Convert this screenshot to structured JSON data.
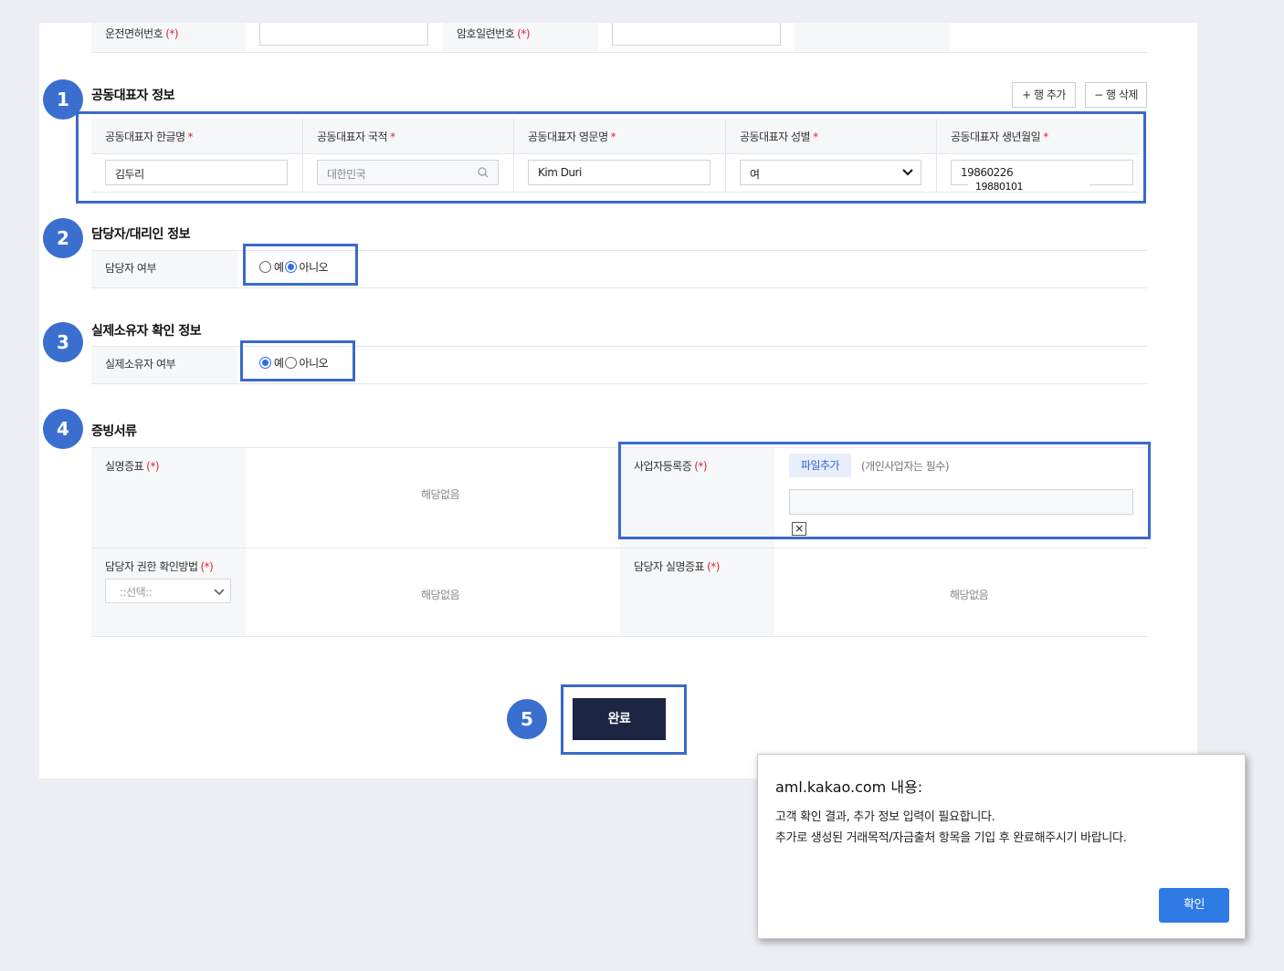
{
  "top_row": {
    "license_label": "운전면허번호",
    "serial_label": "암호일련번호",
    "required_mark": "(*)"
  },
  "section1": {
    "badge": "1",
    "title": "공동대표자 정보",
    "add_row": "+ 행 추가",
    "del_row": "− 행 삭제",
    "columns": [
      "공동대표자 한글명",
      "공동대표자 국적",
      "공동대표자 영문명",
      "공동대표자 성별",
      "공동대표자 생년월일"
    ],
    "required_star": "*",
    "values": {
      "korean_name": "김두리",
      "nationality_placeholder": "대한민국",
      "english_name": "Kim Duri",
      "gender": "여",
      "birthdate": "19860226",
      "birthdate_suggestion": "19880101"
    }
  },
  "section2": {
    "badge": "2",
    "title": "담당자/대리인 정보",
    "row_label": "담당자 여부",
    "yes": "예",
    "no": "아니오",
    "selected": "no"
  },
  "section3": {
    "badge": "3",
    "title": "실제소유자 확인 정보",
    "row_label": "실제소유자 여부",
    "yes": "예",
    "no": "아니오",
    "selected": "yes"
  },
  "section4": {
    "badge": "4",
    "title": "증빙서류",
    "real_name_cert": "실명증표",
    "business_reg": "사업자등록증",
    "file_add": "파일추가",
    "file_note": "(개인사업자는 필수)",
    "authority_method": "담당자 권한 확인방법",
    "select_placeholder": "::선택::",
    "manager_cert": "담당자 실명증표",
    "not_applicable": "해당없음",
    "remove_symbol": "×"
  },
  "footer": {
    "badge": "5",
    "complete_label": "완료"
  },
  "dialog": {
    "title": "aml.kakao.com 내용:",
    "line1": "고객 확인 결과, 추가 정보 입력이 필요합니다.",
    "line2": "추가로 생성된 거래목적/자금출처 항목을 기입 후 완료해주시기 바랍니다.",
    "ok_label": "확인"
  },
  "colors": {
    "badge": "#3a6fd0",
    "highlight": "#3a6ac8",
    "complete_button": "#1c2542",
    "dialog_button": "#2f7be6",
    "required": "#e0262f"
  }
}
